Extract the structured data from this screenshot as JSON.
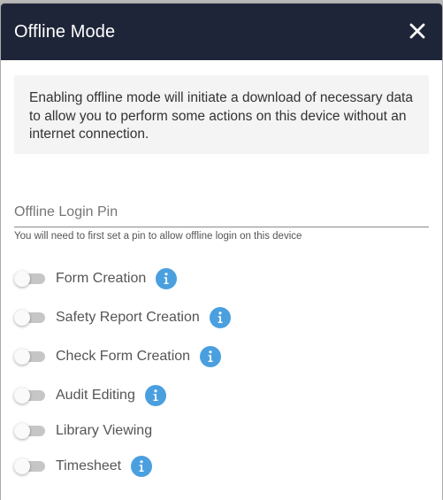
{
  "dialog": {
    "title": "Offline Mode",
    "close_icon": "close-icon",
    "description": "Enabling offline mode will initiate a download of necessary data to allow you to perform some actions on this device without an internet connection."
  },
  "pin": {
    "placeholder": "Offline Login Pin",
    "value": "",
    "helper": "You will need to first set a pin to allow offline login on this device"
  },
  "toggles": [
    {
      "label": "Form Creation",
      "enabled": false,
      "has_info": true
    },
    {
      "label": "Safety Report Creation",
      "enabled": false,
      "has_info": true
    },
    {
      "label": "Check Form Creation",
      "enabled": false,
      "has_info": true
    },
    {
      "label": "Audit Editing",
      "enabled": false,
      "has_info": true
    },
    {
      "label": "Library Viewing",
      "enabled": false,
      "has_info": false
    },
    {
      "label": "Timesheet",
      "enabled": false,
      "has_info": true
    }
  ],
  "colors": {
    "header_bg": "#1f2538",
    "info_icon": "#4a9fdf",
    "switch_track_off": "#c6c6c6",
    "info_box_bg": "#f4f4f4"
  }
}
